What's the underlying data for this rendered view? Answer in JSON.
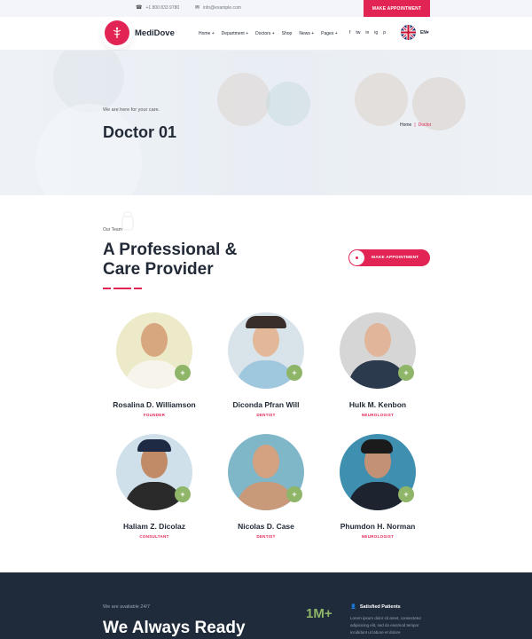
{
  "topbar": {
    "phone": "+1 800 833 9780",
    "email": "info@example.com",
    "appointment_label": "MAKE APPOINTMENT"
  },
  "header": {
    "brand": "MediDove",
    "nav": [
      "Home +",
      "Department +",
      "Doctors +",
      "Shop",
      "News +",
      "Pages +"
    ],
    "social": [
      "f",
      "tw",
      "in",
      "ig",
      "p"
    ],
    "language": "EN▾"
  },
  "hero": {
    "subtitle": "We are here for your care.",
    "title": "Doctor 01",
    "breadcrumb": {
      "home": "Home",
      "separator": "|",
      "current": "Doctor"
    }
  },
  "team": {
    "eyebrow": "Our Team",
    "title_line1": "A Professional &",
    "title_line2": "Care Provider",
    "appointment_label": "MAKE APPOINTMENT",
    "plus": "+",
    "doctors": [
      {
        "name": "Rosalina D. Williamson",
        "role": "FOUNDER"
      },
      {
        "name": "Diconda Pfran Will",
        "role": "DENTIST"
      },
      {
        "name": "Hulk M. Kenbon",
        "role": "NEUROLOGIST"
      },
      {
        "name": "Haliam Z. Dicolaz",
        "role": "CONSULTANT"
      },
      {
        "name": "Nicolas D. Case",
        "role": "DENTIST"
      },
      {
        "name": "Phumdon H. Norman",
        "role": "NEUROLOGIST"
      }
    ]
  },
  "band": {
    "subtitle": "We are available 24/7",
    "title": "We Always Ready",
    "stat": "1M+",
    "stat_heading": "Satisfied Patients",
    "stat_text": "Lorem ipsum dolor sit amet, consectetur adipisicing elit, sed do eiusmod tempor incididunt ut labore et dolore"
  },
  "colors": {
    "accent": "#e12454",
    "green": "#8fb569",
    "dark": "#222a37",
    "band": "#1f2a3a"
  }
}
